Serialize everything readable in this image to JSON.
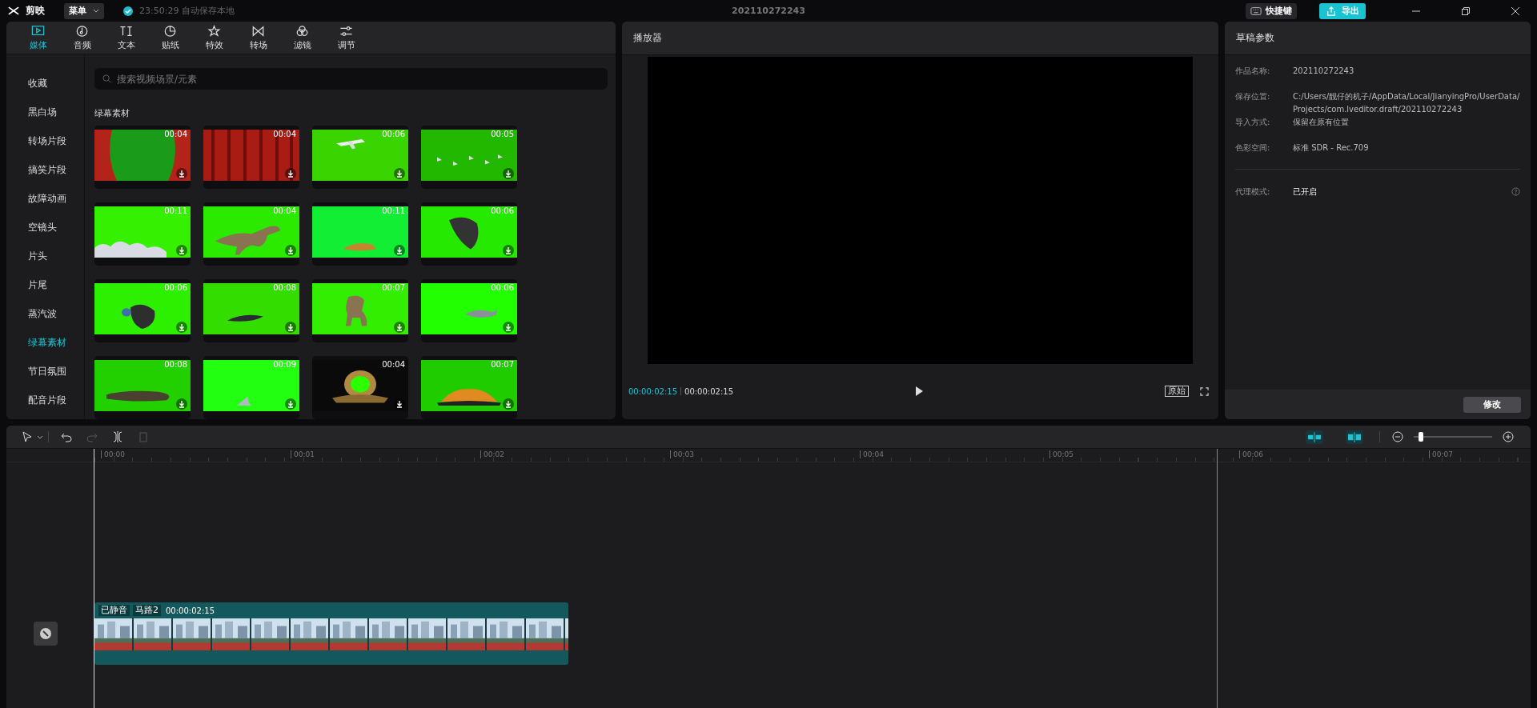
{
  "titlebar": {
    "app_name": "剪映",
    "menu": "菜单",
    "autosave": "23:50:29 自动保存本地",
    "project_title": "202110272243",
    "shortcuts": "快捷键",
    "export": "导出"
  },
  "media_panel": {
    "tabs": [
      {
        "label": "媒体",
        "selected": true
      },
      {
        "label": "音频",
        "selected": false
      },
      {
        "label": "文本",
        "selected": false
      },
      {
        "label": "贴纸",
        "selected": false
      },
      {
        "label": "特效",
        "selected": false
      },
      {
        "label": "转场",
        "selected": false
      },
      {
        "label": "滤镜",
        "selected": false
      },
      {
        "label": "调节",
        "selected": false
      }
    ],
    "categories": [
      {
        "label": "收藏",
        "selected": false
      },
      {
        "label": "黑白场",
        "selected": false
      },
      {
        "label": "转场片段",
        "selected": false
      },
      {
        "label": "搞笑片段",
        "selected": false
      },
      {
        "label": "故障动画",
        "selected": false
      },
      {
        "label": "空镜头",
        "selected": false
      },
      {
        "label": "片头",
        "selected": false
      },
      {
        "label": "片尾",
        "selected": false
      },
      {
        "label": "蒸汽波",
        "selected": false
      },
      {
        "label": "绿幕素材",
        "selected": true
      },
      {
        "label": "节日氛围",
        "selected": false
      },
      {
        "label": "配音片段",
        "selected": false
      }
    ],
    "search": {
      "placeholder": "搜索视频场景/元素"
    },
    "section_title": "绿幕素材",
    "tiles": [
      {
        "duration": "00:04",
        "kind": "picture"
      },
      {
        "duration": "00:04",
        "kind": "picture"
      },
      {
        "duration": "00:06",
        "kind": "picture"
      },
      {
        "duration": "00:05",
        "kind": "picture"
      },
      {
        "duration": "00:11",
        "kind": "picture"
      },
      {
        "duration": "00:04",
        "kind": "picture"
      },
      {
        "duration": "00:11",
        "kind": "picture"
      },
      {
        "duration": "00:06",
        "kind": "picture"
      },
      {
        "duration": "00:06",
        "kind": "picture"
      },
      {
        "duration": "00:08",
        "kind": "picture"
      },
      {
        "duration": "00:07",
        "kind": "picture"
      },
      {
        "duration": "00:06",
        "kind": "picture"
      },
      {
        "duration": "00:08",
        "kind": "picture"
      },
      {
        "duration": "00:09",
        "kind": "picture"
      },
      {
        "duration": "00:04",
        "kind": "picture"
      },
      {
        "duration": "00:07",
        "kind": "picture"
      }
    ]
  },
  "player": {
    "title": "播放器",
    "current_time": "00:00:02:15",
    "total_time": "00:00:02:15",
    "ratio_button": "原始"
  },
  "draft_params": {
    "title": "草稿参数",
    "fields": [
      {
        "label": "作品名称:",
        "value": "202110272243"
      },
      {
        "label": "保存位置:",
        "value": "C:/Users/靓仔的机子/AppData/Local/JianyingPro/UserData/Projects/com.lveditor.draft/202110272243"
      },
      {
        "label": "导入方式:",
        "value": "保留在原有位置"
      },
      {
        "label": "色彩空间:",
        "value": "标准 SDR - Rec.709"
      }
    ],
    "proxy": {
      "label": "代理模式:",
      "value": "已开启"
    },
    "button": "修改"
  },
  "timeline": {
    "zoom": {
      "level": 0.06
    },
    "ruler": [
      "00:00",
      "00:01",
      "00:02",
      "00:03",
      "00:04",
      "00:05",
      "00:06",
      "00:07"
    ],
    "clip": {
      "muted_tag": "已静音",
      "name": "马路2",
      "duration": "00:00:02:15"
    }
  }
}
